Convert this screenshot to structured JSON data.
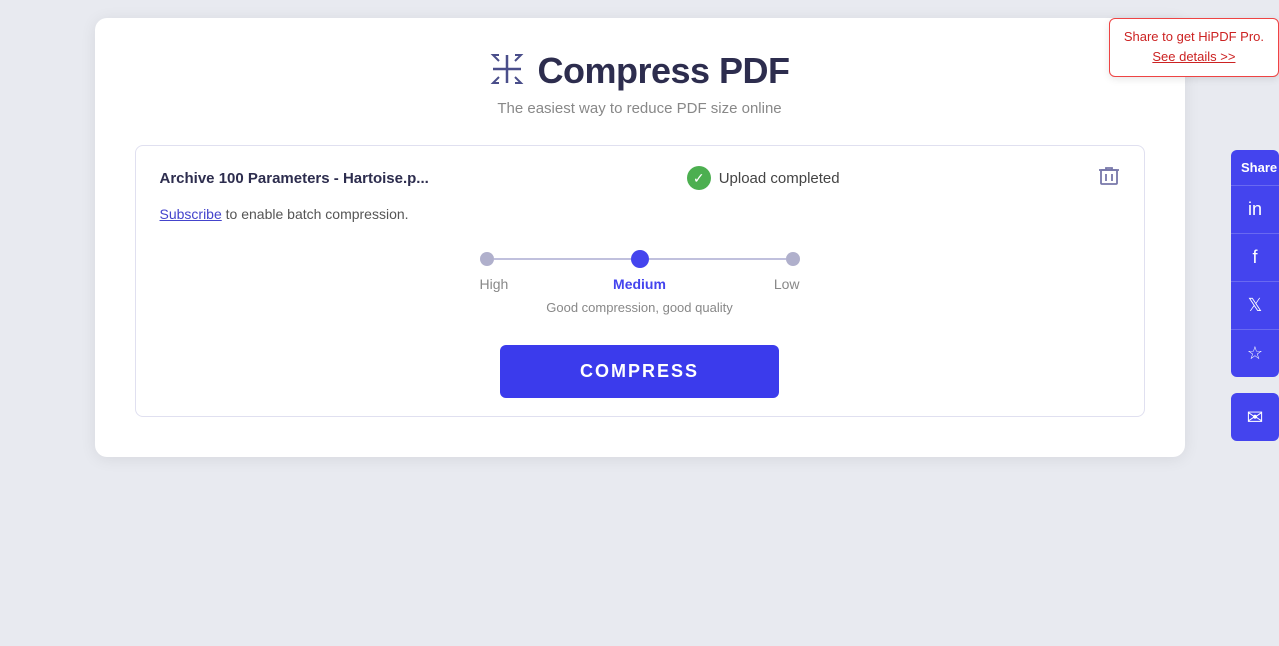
{
  "page": {
    "background": "#e8eaf0"
  },
  "header": {
    "icon": "⊛",
    "title": "Compress PDF",
    "subtitle": "The easiest way to reduce PDF size online"
  },
  "promo": {
    "main_text": "Share to get HiPDF Pro.",
    "link_text": "See details >>"
  },
  "file": {
    "name": "Archive 100 Parameters - Hartoise.p...",
    "status": "Upload completed",
    "delete_title": "Delete"
  },
  "subscribe": {
    "link_text": "Subscribe",
    "suffix_text": " to enable batch compression."
  },
  "compression": {
    "levels": [
      {
        "label": "High",
        "position": "left"
      },
      {
        "label": "Medium",
        "position": "center",
        "active": true
      },
      {
        "label": "Low",
        "position": "right"
      }
    ],
    "description": "Good compression, good quality"
  },
  "buttons": {
    "compress": "COMPRESS"
  },
  "share": {
    "label": "Share",
    "linkedin_icon": "in",
    "facebook_icon": "f",
    "twitter_icon": "𝕏",
    "star_icon": "☆",
    "email_icon": "✉"
  }
}
